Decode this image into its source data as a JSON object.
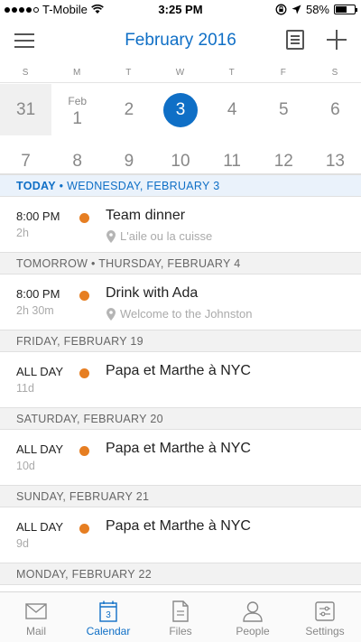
{
  "status": {
    "carrier": "T-Mobile",
    "time": "3:25 PM",
    "battery": "58%",
    "battery_level": 0.58
  },
  "header": {
    "title": "February 2016"
  },
  "weekdays": [
    "S",
    "M",
    "T",
    "W",
    "T",
    "F",
    "S"
  ],
  "calendar": {
    "week1": [
      {
        "num": "31",
        "month": "",
        "style": "prev"
      },
      {
        "num": "1",
        "month": "Feb",
        "style": ""
      },
      {
        "num": "2",
        "month": "",
        "style": ""
      },
      {
        "num": "3",
        "month": "",
        "style": "selected"
      },
      {
        "num": "4",
        "month": "",
        "style": ""
      },
      {
        "num": "5",
        "month": "",
        "style": ""
      },
      {
        "num": "6",
        "month": "",
        "style": ""
      }
    ],
    "week2": [
      {
        "num": "7"
      },
      {
        "num": "8"
      },
      {
        "num": "9"
      },
      {
        "num": "10"
      },
      {
        "num": "11"
      },
      {
        "num": "12"
      },
      {
        "num": "13"
      }
    ]
  },
  "agenda": {
    "today": {
      "label": "TODAY",
      "bullet": "•",
      "date": "WEDNESDAY, FEBRUARY 3",
      "event": {
        "time": "8:00 PM",
        "duration": "2h",
        "title": "Team dinner",
        "location": "L'aile ou la cuisse"
      }
    },
    "tomorrow": {
      "header": "TOMORROW • THURSDAY, FEBRUARY 4",
      "event": {
        "time": "8:00 PM",
        "duration": "2h 30m",
        "title": "Drink with Ada",
        "location": "Welcome to the Johnston"
      }
    },
    "feb19": {
      "header": "FRIDAY, FEBRUARY 19",
      "event": {
        "time": "ALL DAY",
        "duration": "11d",
        "title": "Papa et Marthe à NYC"
      }
    },
    "feb20": {
      "header": "SATURDAY, FEBRUARY 20",
      "event": {
        "time": "ALL DAY",
        "duration": "10d",
        "title": "Papa et Marthe à NYC"
      }
    },
    "feb21": {
      "header": "SUNDAY, FEBRUARY 21",
      "event": {
        "time": "ALL DAY",
        "duration": "9d",
        "title": "Papa et Marthe à NYC"
      }
    },
    "feb22": {
      "header": "MONDAY, FEBRUARY 22"
    }
  },
  "tabs": {
    "mail": "Mail",
    "calendar": "Calendar",
    "calendar_icon_num": "3",
    "files": "Files",
    "people": "People",
    "settings": "Settings"
  },
  "colors": {
    "accent": "#0f6fc6",
    "event_dot": "#e67e22"
  }
}
